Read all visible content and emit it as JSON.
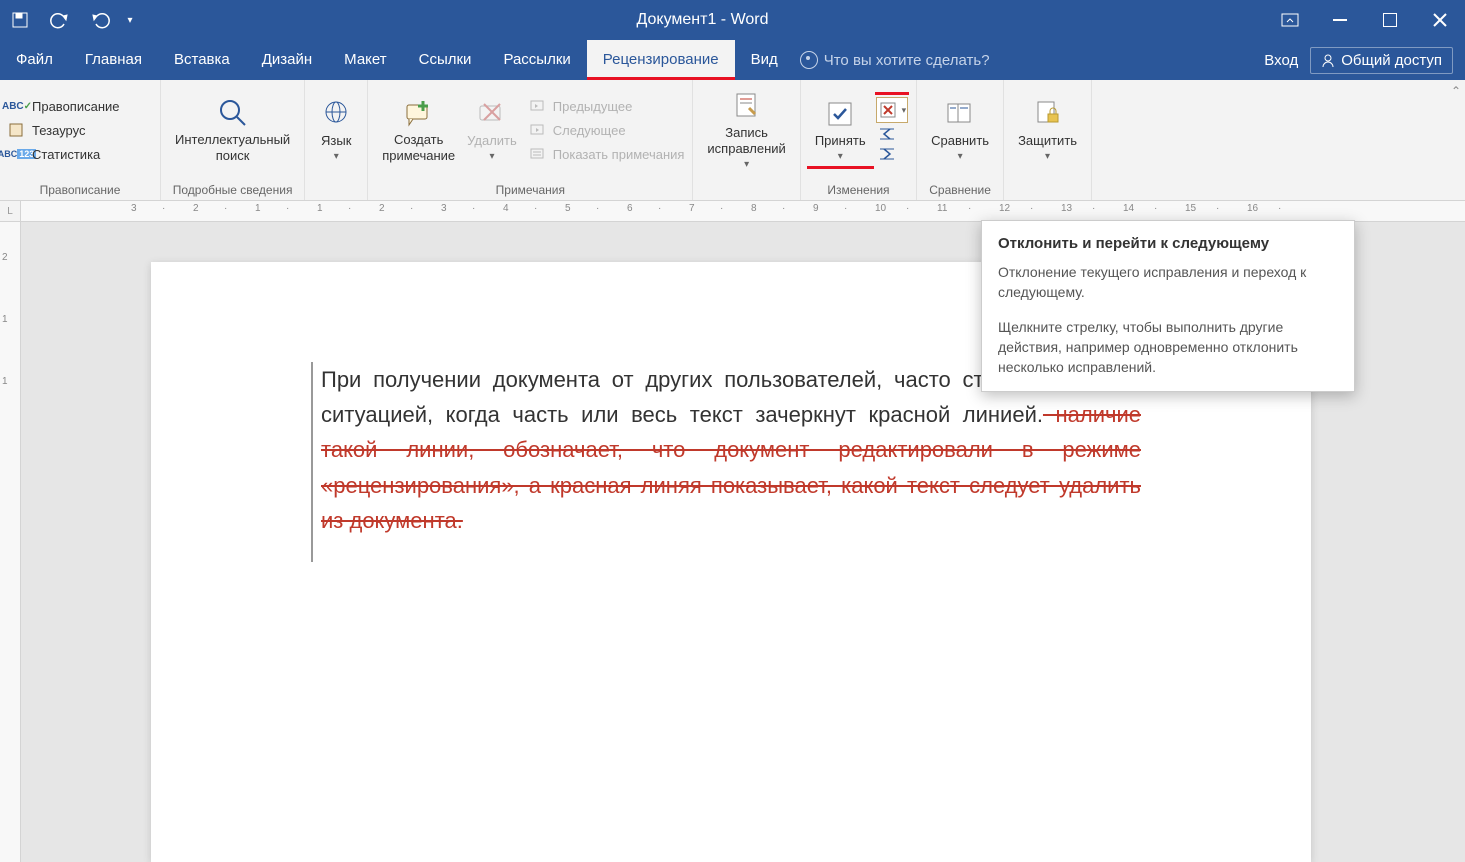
{
  "app": {
    "title": "Документ1 - Word"
  },
  "tabs": {
    "file": "Файл",
    "home": "Главная",
    "insert": "Вставка",
    "design": "Дизайн",
    "layout": "Макет",
    "references": "Ссылки",
    "mailings": "Рассылки",
    "review": "Рецензирование",
    "view": "Вид"
  },
  "tell_me_placeholder": "Что вы хотите сделать?",
  "account": {
    "signin": "Вход",
    "share": "Общий доступ"
  },
  "ribbon": {
    "proofing": {
      "label": "Правописание",
      "spelling": "Правописание",
      "thesaurus": "Тезаурус",
      "stats": "Статистика"
    },
    "insights": {
      "label": "Подробные сведения",
      "smart_lookup": "Интеллектуальный\nпоиск"
    },
    "language": {
      "label": "",
      "btn": "Язык"
    },
    "comments": {
      "label": "Примечания",
      "new": "Создать\nпримечание",
      "delete": "Удалить",
      "prev": "Предыдущее",
      "next": "Следующее",
      "show": "Показать примечания"
    },
    "tracking": {
      "label": "",
      "track": "Запись\nисправлений"
    },
    "changes": {
      "label": "Изменения",
      "accept": "Принять"
    },
    "compare": {
      "label": "Сравнение",
      "btn": "Сравнить"
    },
    "protect": {
      "label": "",
      "btn": "Защитить"
    }
  },
  "tooltip": {
    "title": "Отклонить и перейти к следующему",
    "p1": "Отклонение текущего исправления и переход к следующему.",
    "p2": "Щелкните стрелку, чтобы выполнить другие действия, например одновременно отклонить несколько исправлений."
  },
  "document": {
    "normal": "При получении документа от других пользователей, часто сталкиваешься с ситуацией, когда часть или весь текст зачеркнут красной линией.",
    "deleted": " наличие такой линии, обозначает, что документ редактировали в режиме «рецензирования», а красная линяя показывает, какой текст следует удалить из документа."
  },
  "ruler_h": [
    "3",
    "2",
    "1",
    "1",
    "2",
    "3",
    "4",
    "5",
    "6",
    "7",
    "8",
    "9",
    "10",
    "11",
    "12",
    "13",
    "14",
    "15",
    "16"
  ],
  "ruler_v": [
    "2",
    "1",
    "1"
  ]
}
